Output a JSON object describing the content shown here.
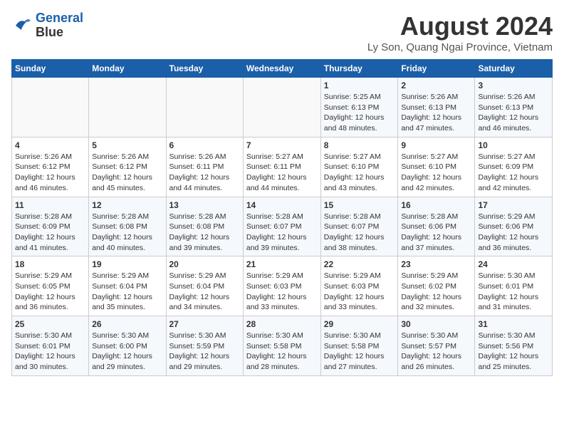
{
  "logo": {
    "line1": "General",
    "line2": "Blue"
  },
  "title": "August 2024",
  "subtitle": "Ly Son, Quang Ngai Province, Vietnam",
  "days_of_week": [
    "Sunday",
    "Monday",
    "Tuesday",
    "Wednesday",
    "Thursday",
    "Friday",
    "Saturday"
  ],
  "weeks": [
    [
      {
        "day": "",
        "info": ""
      },
      {
        "day": "",
        "info": ""
      },
      {
        "day": "",
        "info": ""
      },
      {
        "day": "",
        "info": ""
      },
      {
        "day": "1",
        "info": "Sunrise: 5:25 AM\nSunset: 6:13 PM\nDaylight: 12 hours\nand 48 minutes."
      },
      {
        "day": "2",
        "info": "Sunrise: 5:26 AM\nSunset: 6:13 PM\nDaylight: 12 hours\nand 47 minutes."
      },
      {
        "day": "3",
        "info": "Sunrise: 5:26 AM\nSunset: 6:13 PM\nDaylight: 12 hours\nand 46 minutes."
      }
    ],
    [
      {
        "day": "4",
        "info": "Sunrise: 5:26 AM\nSunset: 6:12 PM\nDaylight: 12 hours\nand 46 minutes."
      },
      {
        "day": "5",
        "info": "Sunrise: 5:26 AM\nSunset: 6:12 PM\nDaylight: 12 hours\nand 45 minutes."
      },
      {
        "day": "6",
        "info": "Sunrise: 5:26 AM\nSunset: 6:11 PM\nDaylight: 12 hours\nand 44 minutes."
      },
      {
        "day": "7",
        "info": "Sunrise: 5:27 AM\nSunset: 6:11 PM\nDaylight: 12 hours\nand 44 minutes."
      },
      {
        "day": "8",
        "info": "Sunrise: 5:27 AM\nSunset: 6:10 PM\nDaylight: 12 hours\nand 43 minutes."
      },
      {
        "day": "9",
        "info": "Sunrise: 5:27 AM\nSunset: 6:10 PM\nDaylight: 12 hours\nand 42 minutes."
      },
      {
        "day": "10",
        "info": "Sunrise: 5:27 AM\nSunset: 6:09 PM\nDaylight: 12 hours\nand 42 minutes."
      }
    ],
    [
      {
        "day": "11",
        "info": "Sunrise: 5:28 AM\nSunset: 6:09 PM\nDaylight: 12 hours\nand 41 minutes."
      },
      {
        "day": "12",
        "info": "Sunrise: 5:28 AM\nSunset: 6:08 PM\nDaylight: 12 hours\nand 40 minutes."
      },
      {
        "day": "13",
        "info": "Sunrise: 5:28 AM\nSunset: 6:08 PM\nDaylight: 12 hours\nand 39 minutes."
      },
      {
        "day": "14",
        "info": "Sunrise: 5:28 AM\nSunset: 6:07 PM\nDaylight: 12 hours\nand 39 minutes."
      },
      {
        "day": "15",
        "info": "Sunrise: 5:28 AM\nSunset: 6:07 PM\nDaylight: 12 hours\nand 38 minutes."
      },
      {
        "day": "16",
        "info": "Sunrise: 5:28 AM\nSunset: 6:06 PM\nDaylight: 12 hours\nand 37 minutes."
      },
      {
        "day": "17",
        "info": "Sunrise: 5:29 AM\nSunset: 6:06 PM\nDaylight: 12 hours\nand 36 minutes."
      }
    ],
    [
      {
        "day": "18",
        "info": "Sunrise: 5:29 AM\nSunset: 6:05 PM\nDaylight: 12 hours\nand 36 minutes."
      },
      {
        "day": "19",
        "info": "Sunrise: 5:29 AM\nSunset: 6:04 PM\nDaylight: 12 hours\nand 35 minutes."
      },
      {
        "day": "20",
        "info": "Sunrise: 5:29 AM\nSunset: 6:04 PM\nDaylight: 12 hours\nand 34 minutes."
      },
      {
        "day": "21",
        "info": "Sunrise: 5:29 AM\nSunset: 6:03 PM\nDaylight: 12 hours\nand 33 minutes."
      },
      {
        "day": "22",
        "info": "Sunrise: 5:29 AM\nSunset: 6:03 PM\nDaylight: 12 hours\nand 33 minutes."
      },
      {
        "day": "23",
        "info": "Sunrise: 5:29 AM\nSunset: 6:02 PM\nDaylight: 12 hours\nand 32 minutes."
      },
      {
        "day": "24",
        "info": "Sunrise: 5:30 AM\nSunset: 6:01 PM\nDaylight: 12 hours\nand 31 minutes."
      }
    ],
    [
      {
        "day": "25",
        "info": "Sunrise: 5:30 AM\nSunset: 6:01 PM\nDaylight: 12 hours\nand 30 minutes."
      },
      {
        "day": "26",
        "info": "Sunrise: 5:30 AM\nSunset: 6:00 PM\nDaylight: 12 hours\nand 29 minutes."
      },
      {
        "day": "27",
        "info": "Sunrise: 5:30 AM\nSunset: 5:59 PM\nDaylight: 12 hours\nand 29 minutes."
      },
      {
        "day": "28",
        "info": "Sunrise: 5:30 AM\nSunset: 5:58 PM\nDaylight: 12 hours\nand 28 minutes."
      },
      {
        "day": "29",
        "info": "Sunrise: 5:30 AM\nSunset: 5:58 PM\nDaylight: 12 hours\nand 27 minutes."
      },
      {
        "day": "30",
        "info": "Sunrise: 5:30 AM\nSunset: 5:57 PM\nDaylight: 12 hours\nand 26 minutes."
      },
      {
        "day": "31",
        "info": "Sunrise: 5:30 AM\nSunset: 5:56 PM\nDaylight: 12 hours\nand 25 minutes."
      }
    ]
  ]
}
